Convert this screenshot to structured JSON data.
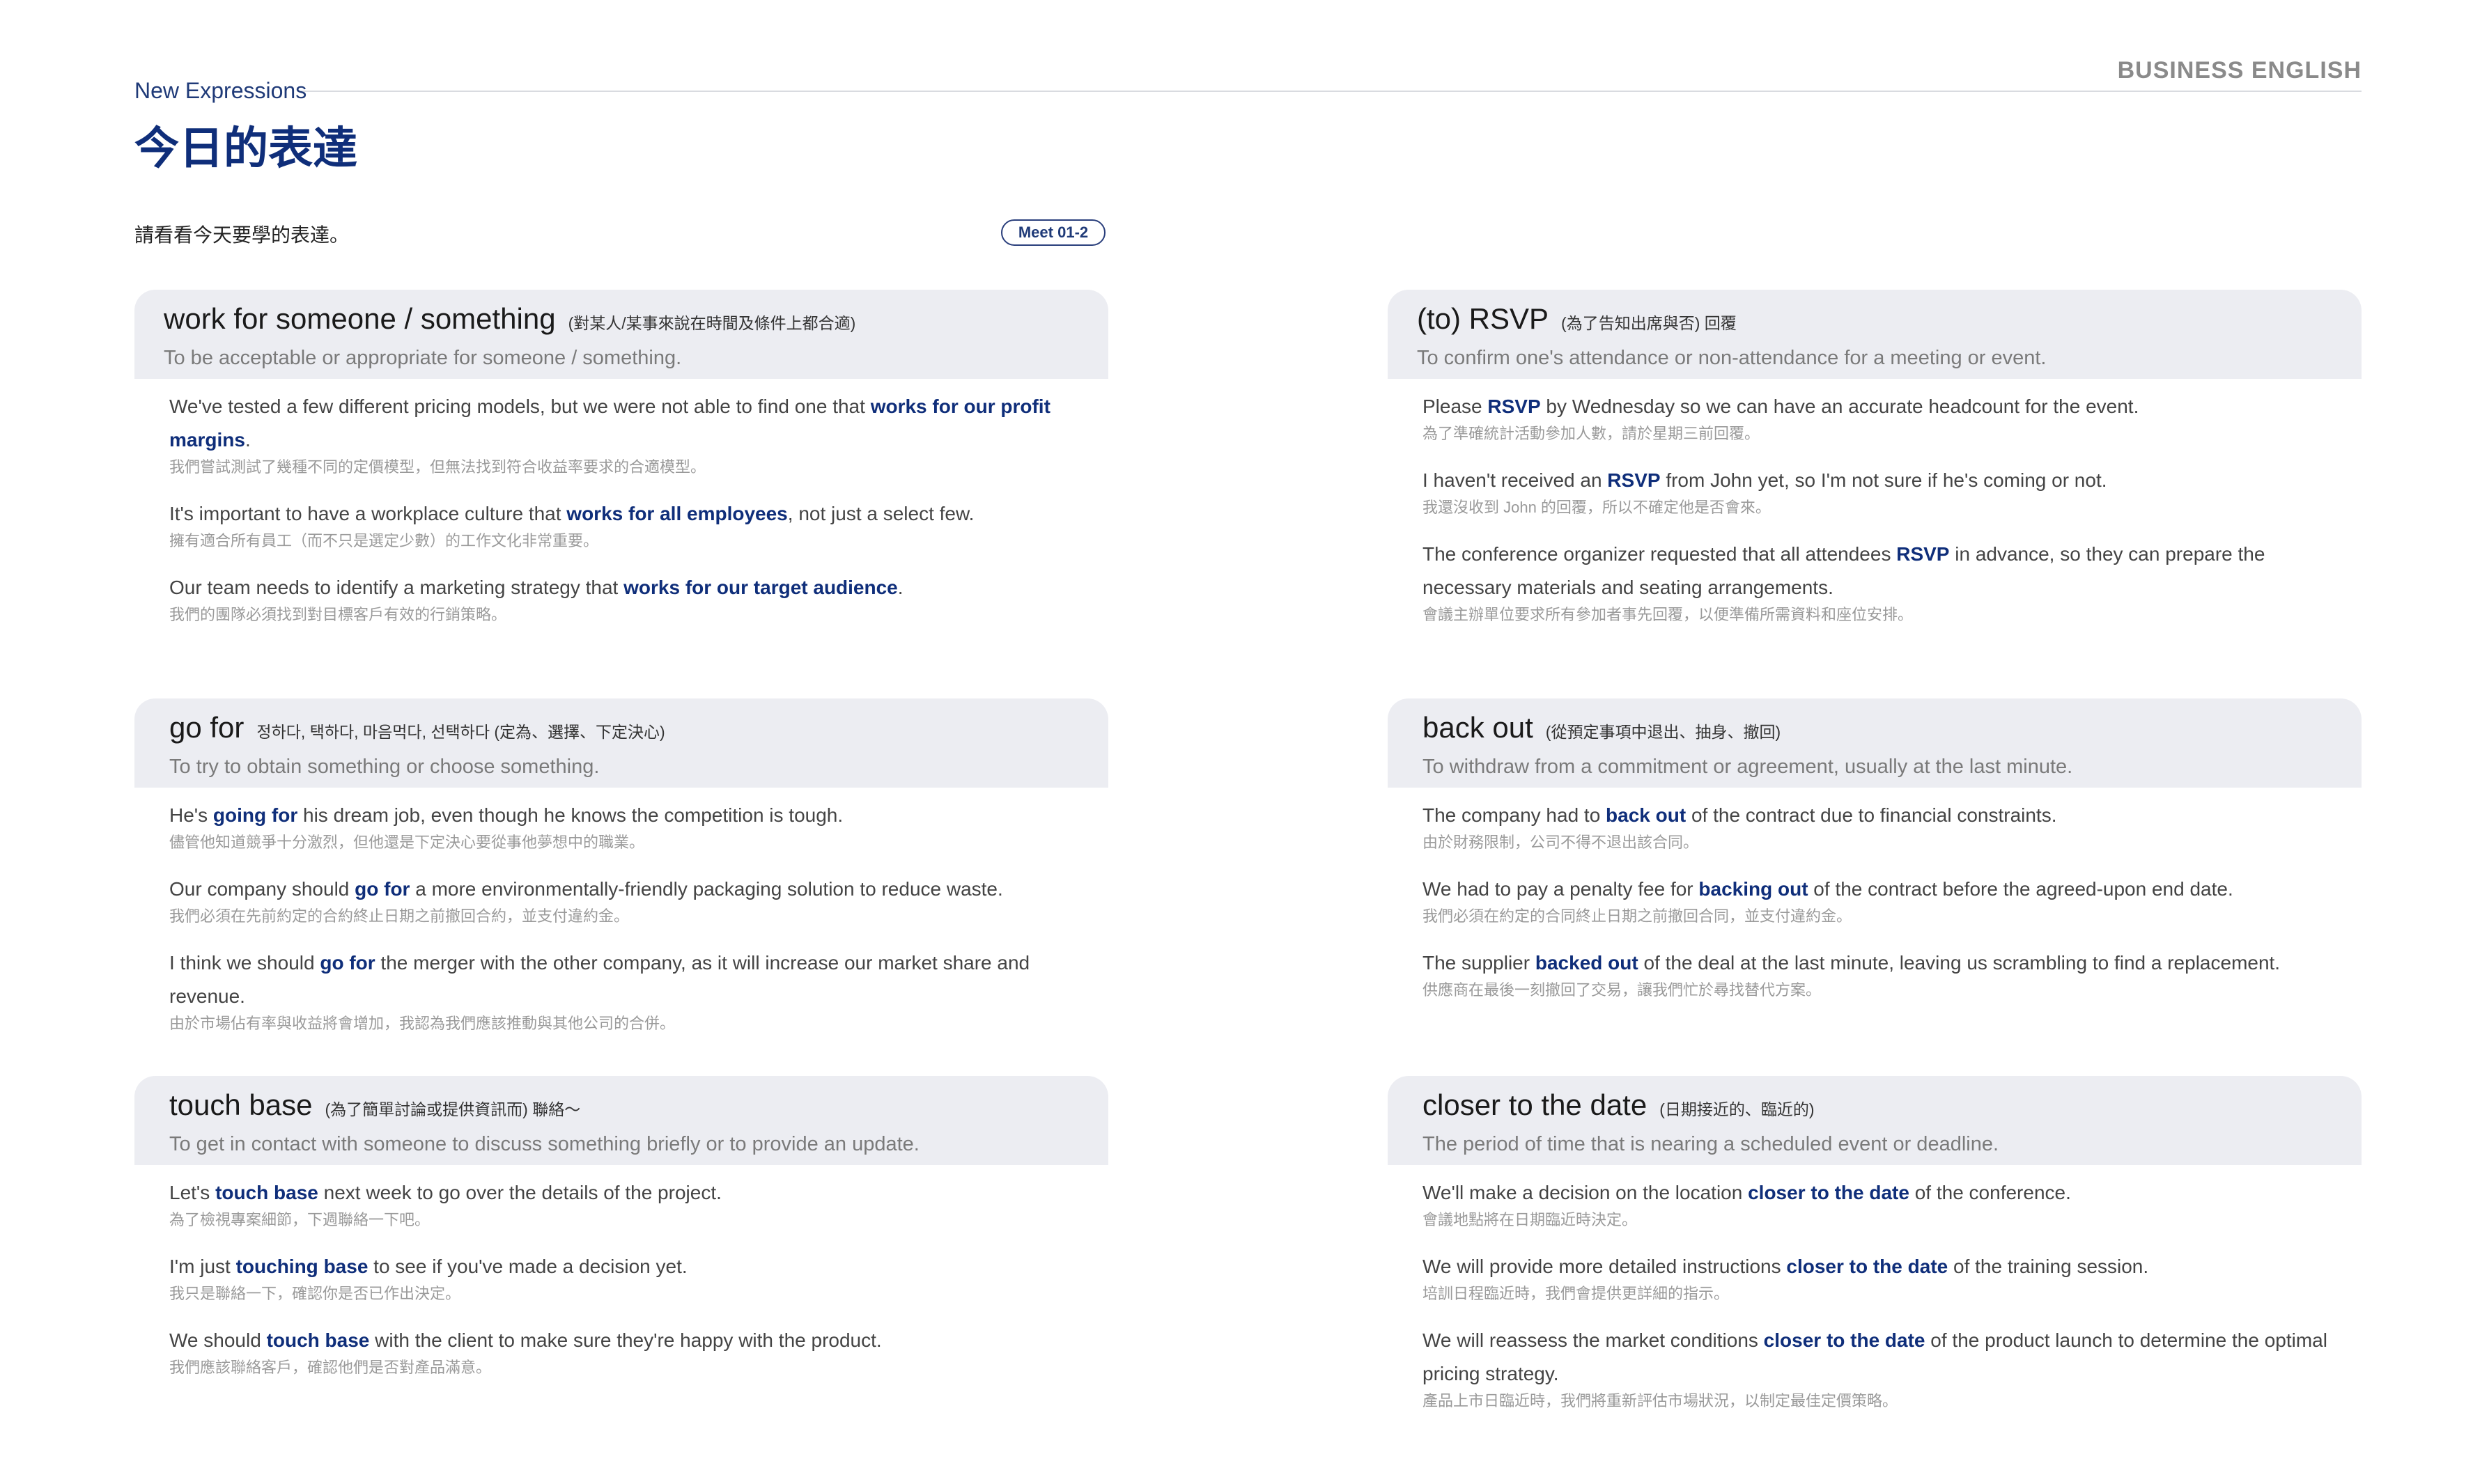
{
  "header": {
    "section_label": "New Expressions",
    "brand": "BUSINESS ENGLISH",
    "title": "今日的表達",
    "intro": "請看看今天要學的表達。",
    "code": "Meet 01-2"
  },
  "cards": [
    {
      "expression": "work for someone / something",
      "gloss": "(對某人/某事來說在時間及條件上都合適)",
      "definition": "To be acceptable or appropriate for someone / something.",
      "examples": [
        {
          "pre": "We've tested a few different pricing models, but we were not able to find one that ",
          "key": "works for our profit margins",
          "post": ".",
          "zh": "我們嘗試測試了幾種不同的定價模型，但無法找到符合收益率要求的合適模型。"
        },
        {
          "pre": "It's important to have a workplace culture that ",
          "key": "works for all employees",
          "post": ", not just a select few.",
          "zh": "擁有適合所有員工（而不只是選定少數）的工作文化非常重要。"
        },
        {
          "pre": "Our team needs to identify a marketing strategy that ",
          "key": "works for our target audience",
          "post": ".",
          "zh": "我們的團隊必須找到對目標客戶有效的行銷策略。"
        }
      ]
    },
    {
      "expression": "(to) RSVP",
      "gloss": "(為了告知出席與否) 回覆",
      "definition": "To confirm one's attendance or non-attendance for a meeting or event.",
      "examples": [
        {
          "pre": "Please ",
          "key": "RSVP",
          "post": " by Wednesday so we can have an accurate headcount for the event.",
          "zh": "為了準確統計活動參加人數，請於星期三前回覆。"
        },
        {
          "pre": "I haven't received an ",
          "key": "RSVP",
          "post": " from John yet, so I'm not sure if he's coming or not.",
          "zh": "我還沒收到 John 的回覆，所以不確定他是否會來。"
        },
        {
          "pre": "The conference organizer requested that all attendees ",
          "key": "RSVP",
          "post": " in advance, so they can prepare the necessary materials and seating arrangements.",
          "zh": "會議主辦單位要求所有參加者事先回覆，以便準備所需資料和座位安排。"
        }
      ]
    },
    {
      "expression": "go for",
      "gloss": "정하다, 택하다, 마음먹다, 선택하다 (定為、選擇、下定決心)",
      "definition": "To try to obtain something or choose something.",
      "examples": [
        {
          "pre": "He's ",
          "key": "going for",
          "post": " his dream job, even though he knows the competition is tough.",
          "zh": "儘管他知道競爭十分激烈，但他還是下定決心要從事他夢想中的職業。"
        },
        {
          "pre": "Our company should ",
          "key": "go for",
          "post": " a more environmentally-friendly packaging solution to reduce waste.",
          "zh": "我們必須在先前約定的合約終止日期之前撤回合約，並支付違約金。"
        },
        {
          "pre": "I think we should ",
          "key": "go for",
          "post": " the merger with the other company, as it will increase our market share and revenue.",
          "zh": "由於市場佔有率與收益將會增加，我認為我們應該推動與其他公司的合併。"
        }
      ]
    },
    {
      "expression": "back out",
      "gloss": "(從預定事項中退出、抽身、撤回)",
      "definition": "To withdraw from a commitment or agreement, usually at the last minute.",
      "examples": [
        {
          "pre": "The company had to ",
          "key": "back out",
          "post": " of the contract due to financial constraints.",
          "zh": "由於財務限制，公司不得不退出該合同。"
        },
        {
          "pre": "We had to pay a penalty fee for ",
          "key": "backing out",
          "post": " of the contract before the agreed-upon end date.",
          "zh": "我們必須在約定的合同終止日期之前撤回合同，並支付違約金。"
        },
        {
          "pre": "The supplier ",
          "key": "backed out",
          "post": " of the deal at the last minute, leaving us scrambling to find a replacement.",
          "zh": "供應商在最後一刻撤回了交易，讓我們忙於尋找替代方案。"
        }
      ]
    },
    {
      "expression": "touch base",
      "gloss": "(為了簡單討論或提供資訊而) 聯絡～",
      "definition": "To get in contact with someone to discuss something briefly or to provide an update.",
      "examples": [
        {
          "pre": "Let's ",
          "key": "touch base",
          "post": " next week to go over the details of the project.",
          "zh": "為了檢視專案細節，下週聯絡一下吧。"
        },
        {
          "pre": "I'm just ",
          "key": "touching base",
          "post": " to see if you've made a decision yet.",
          "zh": "我只是聯絡一下，確認你是否已作出決定。"
        },
        {
          "pre": "We should ",
          "key": "touch base",
          "post": " with the client to make sure they're happy with the product.",
          "zh": "我們應該聯絡客戶，確認他們是否對產品滿意。"
        }
      ]
    },
    {
      "expression": "closer to the date",
      "gloss": "(日期接近的、臨近的)",
      "definition": "The period of time that is nearing a scheduled event or deadline.",
      "examples": [
        {
          "pre": "We'll make a decision on the location ",
          "key": "closer to the date",
          "post": " of the conference.",
          "zh": "會議地點將在日期臨近時決定。"
        },
        {
          "pre": "We will provide more detailed instructions ",
          "key": "closer to the date",
          "post": " of the training session.",
          "zh": "培訓日程臨近時，我們會提供更詳細的指示。"
        },
        {
          "pre": "We will reassess the market conditions ",
          "key": "closer to the date",
          "post": " of the product launch to determine the optimal pricing strategy.",
          "zh": "產品上市日臨近時，我們將重新評估市場狀況，以制定最佳定價策略。"
        }
      ]
    }
  ]
}
